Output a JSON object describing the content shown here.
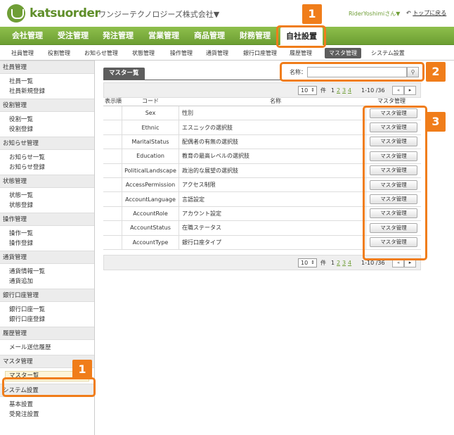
{
  "header": {
    "logo_text": "katsuorder",
    "company": "ワンジーテクノロジーズ株式会社▼",
    "user": "RiderYoshimiさん▼",
    "top_link": "トップに戻る"
  },
  "main_nav": [
    "会社管理",
    "受注管理",
    "発注管理",
    "営業管理",
    "商品管理",
    "財務管理",
    "自社設置"
  ],
  "sub_nav": [
    "社員管理",
    "役割管理",
    "お知らせ管理",
    "状態管理",
    "操作管理",
    "通貨管理",
    "銀行口座管理",
    "履歴管理",
    "マスタ管理",
    "システム設置"
  ],
  "sidebar": [
    {
      "head": "社員管理",
      "links": [
        "社員一覧",
        "社員新規登録"
      ]
    },
    {
      "head": "役割管理",
      "links": [
        "役割一覧",
        "役割登録"
      ]
    },
    {
      "head": "お知らせ管理",
      "links": [
        "お知らせ一覧",
        "お知らせ登録"
      ]
    },
    {
      "head": "状態管理",
      "links": [
        "状態一覧",
        "状態登録"
      ]
    },
    {
      "head": "操作管理",
      "links": [
        "操作一覧",
        "操作登録"
      ]
    },
    {
      "head": "通貨管理",
      "links": [
        "通貨情報一覧",
        "通貨追加"
      ]
    },
    {
      "head": "銀行口座管理",
      "links": [
        "銀行口座一覧",
        "銀行口座登録"
      ]
    },
    {
      "head": "履歴管理",
      "links": [
        "メール送信履歴"
      ]
    },
    {
      "head": "マスタ管理",
      "links": [
        "マスター覧"
      ]
    },
    {
      "head": "システム設置",
      "links": [
        "基本設置",
        "受発注設置"
      ]
    }
  ],
  "panel": {
    "tab": "マスター覧",
    "search_label": "名称：",
    "search_value": "",
    "search_icon": "magnifier-icon"
  },
  "pager": {
    "per_page": "10",
    "ken": "件",
    "pages": [
      "1",
      "2",
      "3",
      "4"
    ],
    "range": "1-10 /36",
    "prev": "◂",
    "next": "▸"
  },
  "table": {
    "headers": [
      "表示順",
      "コード",
      "名称",
      "マスタ管理"
    ],
    "rows": [
      {
        "code": "Sex",
        "name": "性別",
        "action": "マスタ管理"
      },
      {
        "code": "Ethnic",
        "name": "エスニックの選択肢",
        "action": "マスタ管理"
      },
      {
        "code": "MaritalStatus",
        "name": "配偶者の有無の選択肢",
        "action": "マスタ管理"
      },
      {
        "code": "Education",
        "name": "教育の最高レベルの選択肢",
        "action": "マスタ管理"
      },
      {
        "code": "PoliticalLandscape",
        "name": "政治的な展望の選択肢",
        "action": "マスタ管理"
      },
      {
        "code": "AccessPermission",
        "name": "アクセス制限",
        "action": "マスタ管理"
      },
      {
        "code": "AccountLanguage",
        "name": "言語設定",
        "action": "マスタ管理"
      },
      {
        "code": "AccountRole",
        "name": "アカウント設定",
        "action": "マスタ管理"
      },
      {
        "code": "AccountStatus",
        "name": "在職ステータス",
        "action": "マスタ管理"
      },
      {
        "code": "AccountType",
        "name": "銀行口座タイプ",
        "action": "マスタ管理"
      }
    ]
  },
  "annotations": [
    "1",
    "2",
    "3",
    "1"
  ],
  "colors": {
    "accent": "#6f9e36",
    "highlight": "#f07d1a",
    "tab_dark": "#5d5d5d"
  }
}
